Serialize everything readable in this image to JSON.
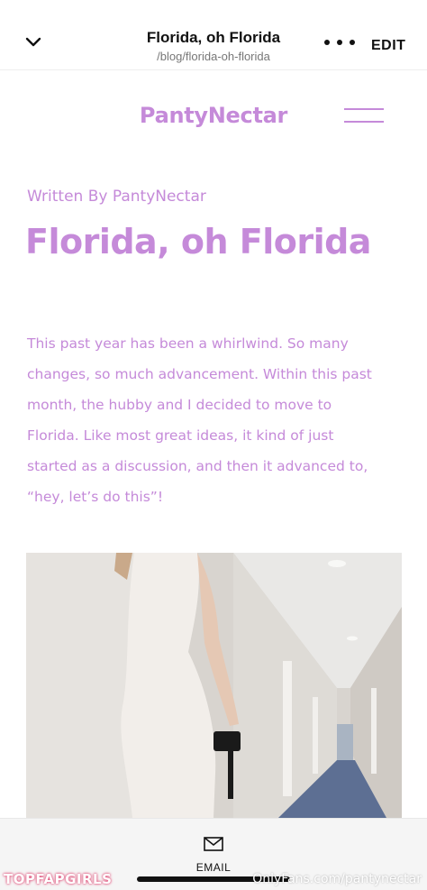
{
  "topbar": {
    "title": "Florida, oh Florida",
    "url": "/blog/florida-oh-florida",
    "edit_label": "EDIT",
    "back_icon": "chevron-down-icon",
    "more_icon": "more-horizontal-icon"
  },
  "site": {
    "name": "PantyNectar",
    "menu_icon": "hamburger-menu-icon",
    "accent_color": "#c58ad9"
  },
  "post": {
    "byline": "Written By PantyNectar",
    "title": "Florida, oh Florida",
    "body_lines": [
      "This past year has been a whirlwind. So many",
      "changes, so much advancement. Within this past",
      "month, the hubby and I decided to move to",
      "Florida. Like most great ideas, it kind of just",
      "started as a discussion, and then it advanced to,",
      "“hey, let’s do this”!"
    ],
    "photo_icon": "photo-image"
  },
  "bottombar": {
    "email_label": "EMAIL",
    "email_icon": "mail-icon"
  },
  "watermarks": {
    "left": "TOPFAPGIRLS",
    "right": "OnlyFans.com/pantynectar"
  }
}
